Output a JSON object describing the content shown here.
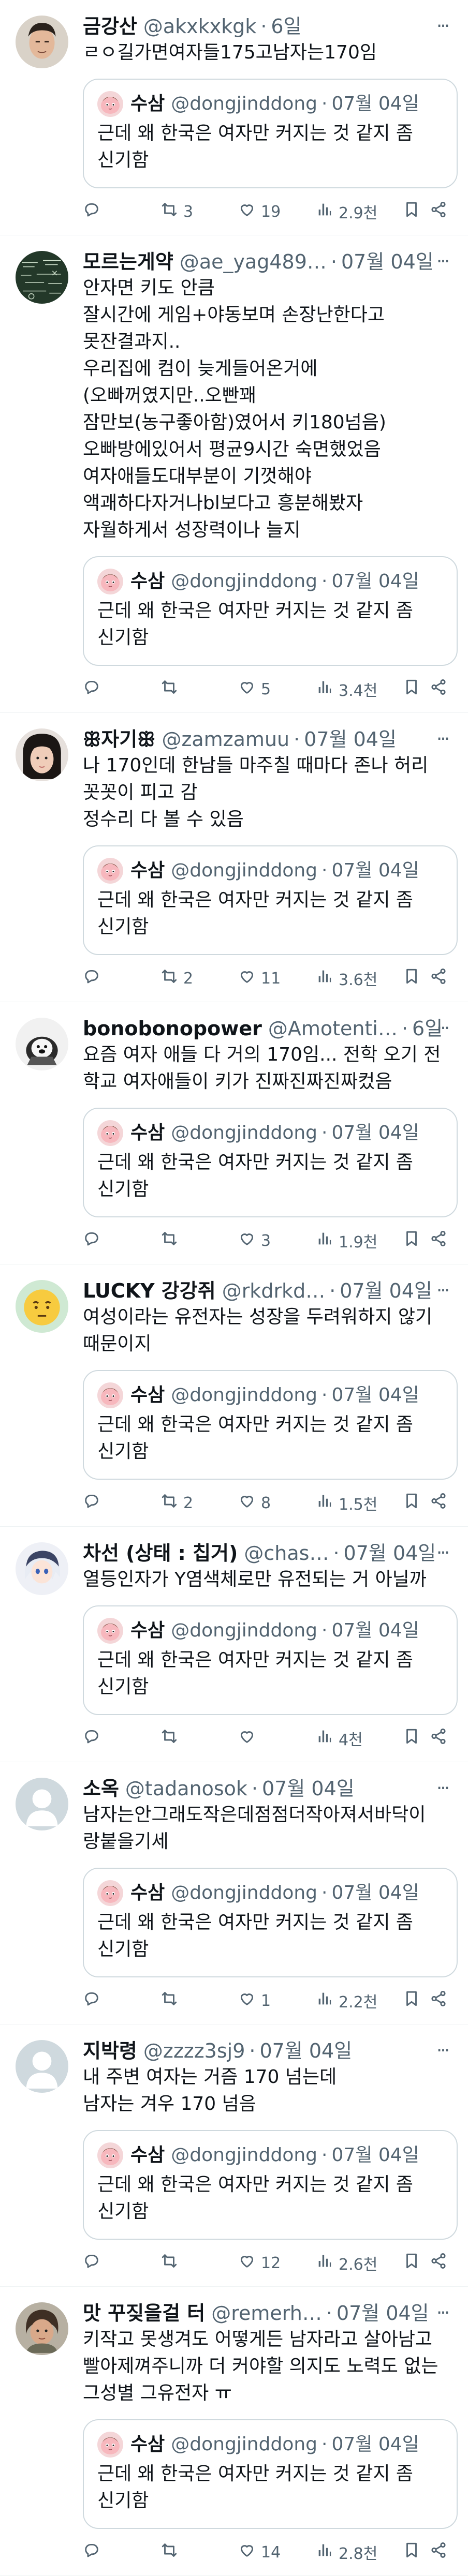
{
  "quoted": {
    "name": "수삼",
    "handle": "@dongjinddong",
    "time": "07월 04일",
    "text": "근데 왜 한국은 여자만 커지는 것 같지 좀\n신기함"
  },
  "icons": {
    "reply": "reply-icon",
    "retweet": "retweet-icon",
    "like": "like-icon",
    "views": "views-icon",
    "bookmark": "bookmark-icon",
    "share": "share-icon",
    "more": "more-icon"
  },
  "more_label": "···",
  "tweets": [
    {
      "name": "금강산",
      "handle": "@akxkxkgk",
      "time": "6일",
      "text": "ㄹㅇ길가면여자들175고남자는170임",
      "replies": "",
      "retweets": "3",
      "likes": "19",
      "views": "2.9천"
    },
    {
      "name": "모르는게약",
      "handle": "@ae_yag489…",
      "time": "07월 04일",
      "text": "안자면 키도 안큼\n잘시간에 게임+야동보며 손장난한다고\n못잔결과지..\n우리집에 컴이 늦게들어온거에\n(오빠꺼였지만..오빤꽤\n잠만보(농구좋아함)였어서 키180넘음)\n오빠방에있어서 평균9시간 숙면했었음\n여자애들도대부분이 기껏해야\n액괘하다자거나bl보다고 흥분해봤자\n자월하게서 성장력이나 늘지",
      "replies": "",
      "retweets": "",
      "likes": "5",
      "views": "3.4천"
    },
    {
      "name": "ꕥ자기ꕥ",
      "handle": "@zamzamuu",
      "time": "07월 04일",
      "text": "나 170인데 한남들 마주칠 때마다 존나 허리\n꼿꼿이 피고 감\n정수리 다 볼 수 있음",
      "replies": "",
      "retweets": "2",
      "likes": "11",
      "views": "3.6천"
    },
    {
      "name": "bonobonopower",
      "handle": "@Amotenti…",
      "time": "6일",
      "text": "요즘 여자 애들 다 거의 170임... 전학 오기 전\n학교 여자애들이 키가 진짜진짜진짜컸음",
      "replies": "",
      "retweets": "",
      "likes": "3",
      "views": "1.9천"
    },
    {
      "name": "LUCKY 강강쥐",
      "handle": "@rkdrkd…",
      "time": "07월 04일",
      "text": "여성이라는 유전자는 성장을 두려워하지 않기\n때문이지",
      "replies": "",
      "retweets": "2",
      "likes": "8",
      "views": "1.5천"
    },
    {
      "name": "차선 (상태 : 칩거)",
      "handle": "@chas…",
      "time": "07월 04일",
      "text": "열등인자가 Y염색체로만 유전되는 거 아닐까",
      "replies": "",
      "retweets": "",
      "likes": "",
      "views": "4천"
    },
    {
      "name": "소옥",
      "handle": "@tadanosok",
      "time": "07월 04일",
      "text": "남자는안그래도작은데점점더작아져서바닥이\n랑붙을기세",
      "replies": "",
      "retweets": "",
      "likes": "1",
      "views": "2.2천"
    },
    {
      "name": "지박령",
      "handle": "@zzzz3sj9",
      "time": "07월 04일",
      "text": "내 주변 여자는 거즘 170 넘는데\n남자는 겨우 170 넘음",
      "replies": "",
      "retweets": "",
      "likes": "12",
      "views": "2.6천"
    },
    {
      "name": "맛 꾸짖을걸 터",
      "handle": "@remerh…",
      "time": "07월 04일",
      "text": "키작고 못생겨도 어떻게든 남자라고 살아남고\n빨아제껴주니까 더 커야할 의지도 노력도 없는\n그성별 그유전자 ㅠ",
      "replies": "",
      "retweets": "",
      "likes": "14",
      "views": "2.8천"
    }
  ]
}
